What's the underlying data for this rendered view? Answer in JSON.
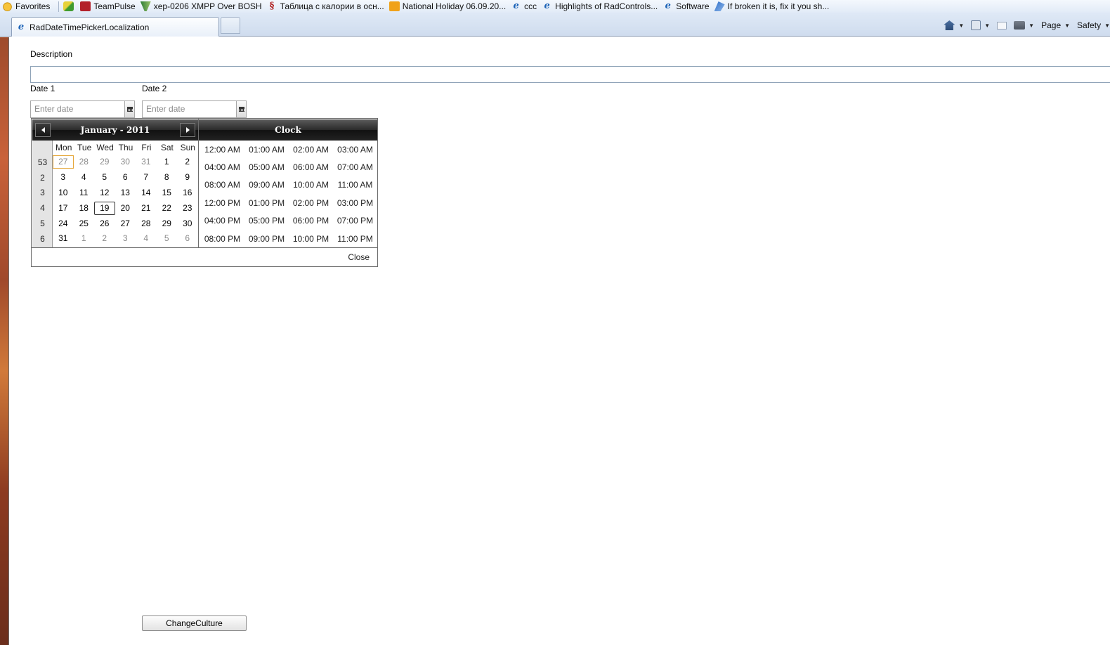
{
  "favorites_bar": {
    "favorites_label": "Favorites",
    "items": [
      {
        "label": "TeamPulse",
        "icon": "teampulse-icon"
      },
      {
        "label": "xep-0206 XMPP Over BOSH",
        "icon": "xep-icon"
      },
      {
        "label": "Таблица с калории в осн...",
        "icon": "s-site-icon"
      },
      {
        "label": "National Holiday 06.09.20...",
        "icon": "holiday-icon"
      },
      {
        "label": "ccc",
        "icon": "ie-page-icon"
      },
      {
        "label": "Highlights of RadControls...",
        "icon": "ie-page-icon"
      },
      {
        "label": "Software",
        "icon": "ie-page-icon"
      },
      {
        "label": "If broken it is, fix it you sh...",
        "icon": "blog-icon"
      }
    ]
  },
  "tab": {
    "title": "RadDateTimePickerLocalization"
  },
  "command_bar": {
    "page_label": "Page",
    "safety_label": "Safety"
  },
  "form": {
    "description_label": "Description",
    "description_value": "",
    "date1_label": "Date 1",
    "date2_label": "Date 2",
    "date1_placeholder": "Enter date",
    "date2_placeholder": "Enter date"
  },
  "calendar": {
    "title": "January - 2011",
    "day_names": [
      "Mon",
      "Tue",
      "Wed",
      "Thu",
      "Fri",
      "Sat",
      "Sun"
    ],
    "weeks": [
      {
        "num": "53",
        "days": [
          "27",
          "28",
          "29",
          "30",
          "31",
          "1",
          "2"
        ]
      },
      {
        "num": "2",
        "days": [
          "3",
          "4",
          "5",
          "6",
          "7",
          "8",
          "9"
        ]
      },
      {
        "num": "3",
        "days": [
          "10",
          "11",
          "12",
          "13",
          "14",
          "15",
          "16"
        ]
      },
      {
        "num": "4",
        "days": [
          "17",
          "18",
          "19",
          "20",
          "21",
          "22",
          "23"
        ]
      },
      {
        "num": "5",
        "days": [
          "24",
          "25",
          "26",
          "27",
          "28",
          "29",
          "30"
        ]
      },
      {
        "num": "6",
        "days": [
          "31",
          "1",
          "2",
          "3",
          "4",
          "5",
          "6"
        ]
      }
    ],
    "selected_day": "19",
    "today_day": "27"
  },
  "clock": {
    "title": "Clock",
    "times": [
      "12:00 AM",
      "01:00 AM",
      "02:00 AM",
      "03:00 AM",
      "04:00 AM",
      "05:00 AM",
      "06:00 AM",
      "07:00 AM",
      "08:00 AM",
      "09:00 AM",
      "10:00 AM",
      "11:00 AM",
      "12:00 PM",
      "01:00 PM",
      "02:00 PM",
      "03:00 PM",
      "04:00 PM",
      "05:00 PM",
      "06:00 PM",
      "07:00 PM",
      "08:00 PM",
      "09:00 PM",
      "10:00 PM",
      "11:00 PM"
    ]
  },
  "popup": {
    "close_label": "Close"
  },
  "buttons": {
    "change_culture": "ChangeCulture"
  }
}
